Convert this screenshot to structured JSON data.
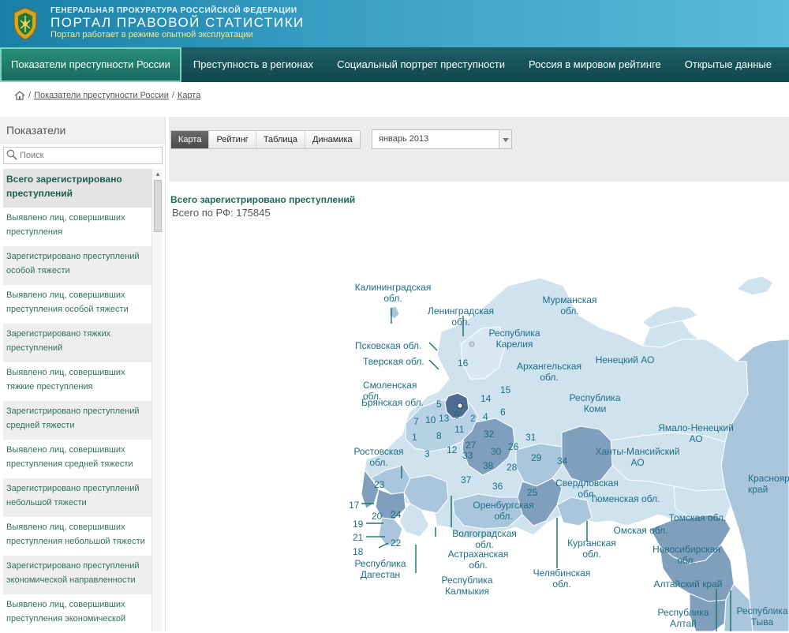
{
  "header": {
    "org": "ГЕНЕРАЛЬНАЯ ПРОКУРАТУРА РОССИЙСКОЙ ФЕДЕРАЦИИ",
    "title": "ПОРТАЛ ПРАВОВОЙ СТАТИСТИКИ",
    "subtitle": "Портал работает в режиме опытной эксплуатации"
  },
  "nav": {
    "items": [
      {
        "label": "Показатели преступности России",
        "active": true
      },
      {
        "label": "Преступность в регионах"
      },
      {
        "label": "Социальный портрет преступности"
      },
      {
        "label": "Россия в мировом рейтинге"
      },
      {
        "label": "Открытые данные"
      },
      {
        "label": "О"
      }
    ]
  },
  "breadcrumb": {
    "sep": "/",
    "items": [
      "Показатели преступности России",
      "Карта"
    ]
  },
  "sidebar": {
    "title": "Показатели",
    "search_placeholder": "Поиск",
    "items": [
      "Всего зарегистрировано преступлений",
      "Выявлено лиц, совершивших преступления",
      "Зарегистрировано преступлений особой тяжести",
      "Выявлено лиц, совершивших преступления особой тяжести",
      "Зарегистрировано тяжких преступлений",
      "Выявлено лиц, совершивших тяжкие преступления",
      "Зарегистрировано преступлений средней тяжести",
      "Выявлено лиц, совершивших преступления средней тяжести",
      "Зарегистрировано преступлений небольшой тяжести",
      "Выявлено лиц, совершивших преступления небольшой тяжести",
      "Зарегистрировано преступлений экономической направленности",
      "Выявлено лиц, совершивших преступления экономической"
    ]
  },
  "toolbar": {
    "tabs": [
      "Карта",
      "Рейтинг",
      "Таблица",
      "Динамика"
    ],
    "period": "январь 2013"
  },
  "stat": {
    "title": "Всего зарегистрировано преступлений",
    "total": "Всего по РФ: 175845"
  },
  "map": {
    "colors": {
      "light": "#cfe3ef",
      "mid": "#a9c6dc",
      "dark": "#7f9fbd",
      "selected": "#4e6b8f",
      "sea": "#ffffff",
      "border": "#ffffff",
      "label": "#1e6d86",
      "leader": "#1a7a6a"
    },
    "region_labels": [
      "Калининградская обл.",
      "Ленинградская обл.",
      "Мурманская обл.",
      "Республика Карелия",
      "Псковская обл.",
      "Тверская обл.",
      "Архангельская обл.",
      "Ненецкий АО",
      "Смоленская обл.",
      "Брянская обл.",
      "Республика Коми",
      "Ямало-Ненецкий АО",
      "Ханты-Мансийский АО",
      "Ростовская обл.",
      "Свердловская обл.",
      "Тюменская обл.",
      "Оренбургская обл.",
      "Волгоградская обл.",
      "Астраханская обл.",
      "Курганская обл.",
      "Омская обл.",
      "Томская обл.",
      "Новосибирская обл.",
      "Республика Калмыкия",
      "Челябинская обл.",
      "Республика Дагестан",
      "Алтайский край",
      "Республика Алтай",
      "Республика Тыва",
      "Красноярский край"
    ],
    "region_numbers": [
      "16",
      "15",
      "14",
      "5",
      "4",
      "6",
      "13",
      "2",
      "9",
      "7",
      "10",
      "1",
      "11",
      "32",
      "31",
      "8",
      "12",
      "27",
      "3",
      "33",
      "30",
      "26",
      "29",
      "34",
      "38",
      "28",
      "37",
      "36",
      "25",
      "23",
      "17",
      "20",
      "24",
      "19",
      "21",
      "22",
      "18"
    ]
  }
}
